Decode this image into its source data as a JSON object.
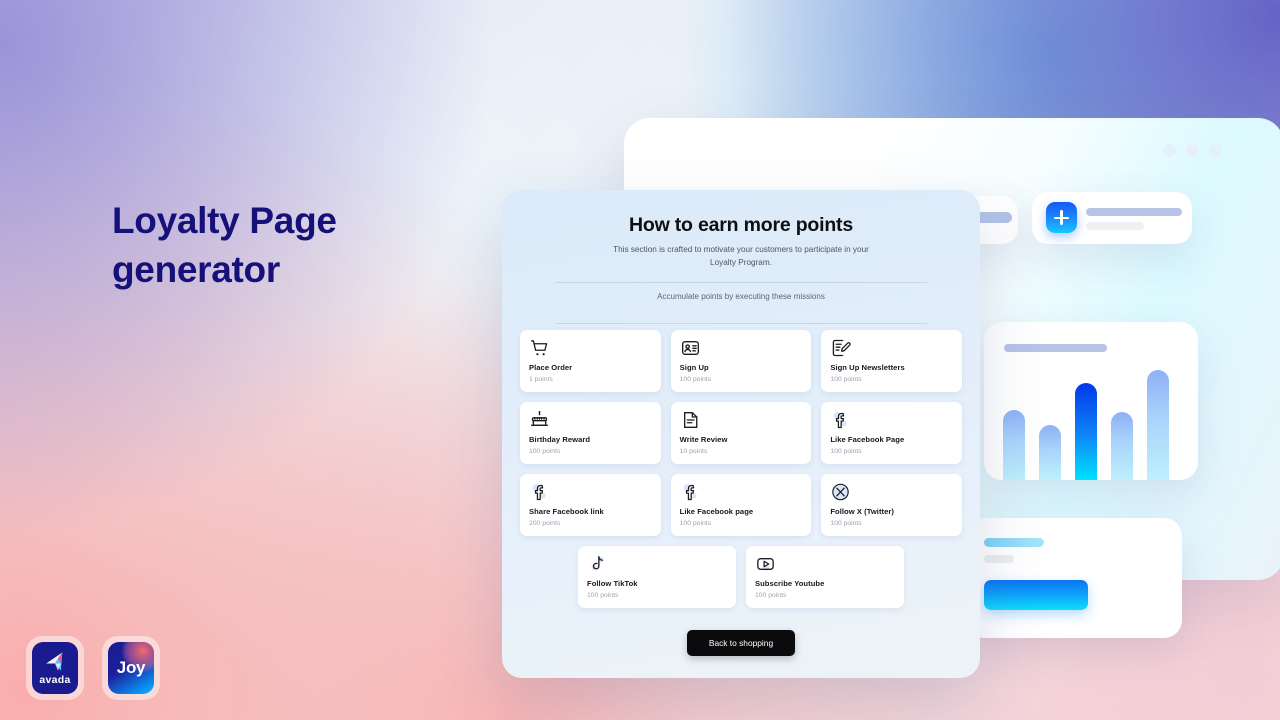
{
  "page": {
    "title": "Loyalty Page generator",
    "title_color": "#151178"
  },
  "card": {
    "heading": "How to earn more points",
    "subheading": "This section is crafted to motivate your customers to participate in your Loyalty Program.",
    "missions_note": "Accumulate points by executing these missions",
    "cta_label": "Back to shopping",
    "cta_color": "#0b0b0d"
  },
  "missions": [
    [
      {
        "icon": "shopping-cart-icon",
        "name": "Place Order",
        "points": "1 points"
      },
      {
        "icon": "id-card-icon",
        "name": "Sign Up",
        "points": "100 points"
      },
      {
        "icon": "newsletter-signup-icon",
        "name": "Sign Up Newsletters",
        "points": "100 points"
      }
    ],
    [
      {
        "icon": "birthday-cake-icon",
        "name": "Birthday Reward",
        "points": "100 points"
      },
      {
        "icon": "write-review-icon",
        "name": "Write Review",
        "points": "10 points"
      },
      {
        "icon": "facebook-icon",
        "name": "Like Facebook Page",
        "points": "100 points"
      }
    ],
    [
      {
        "icon": "facebook-icon",
        "name": "Share Facebook link",
        "points": "200 points"
      },
      {
        "icon": "facebook-icon",
        "name": "Like Facebook page",
        "points": "100 points"
      },
      {
        "icon": "x-twitter-icon",
        "name": "Follow X (Twitter)",
        "points": "100 points"
      }
    ],
    [
      {
        "icon": "tiktok-icon",
        "name": "Follow TikTok",
        "points": "100 points"
      },
      {
        "icon": "youtube-icon",
        "name": "Subscribe Youtube",
        "points": "100 points"
      }
    ]
  ],
  "decor": {
    "chart_bar_heights": [
      64,
      50,
      88,
      62,
      100
    ],
    "accent_blue": "#0f7ff6",
    "placeholder_blue": "#b6c4e6"
  },
  "logos": [
    {
      "name": "avada",
      "label": "avada"
    },
    {
      "name": "joy",
      "label": "Joy"
    }
  ]
}
